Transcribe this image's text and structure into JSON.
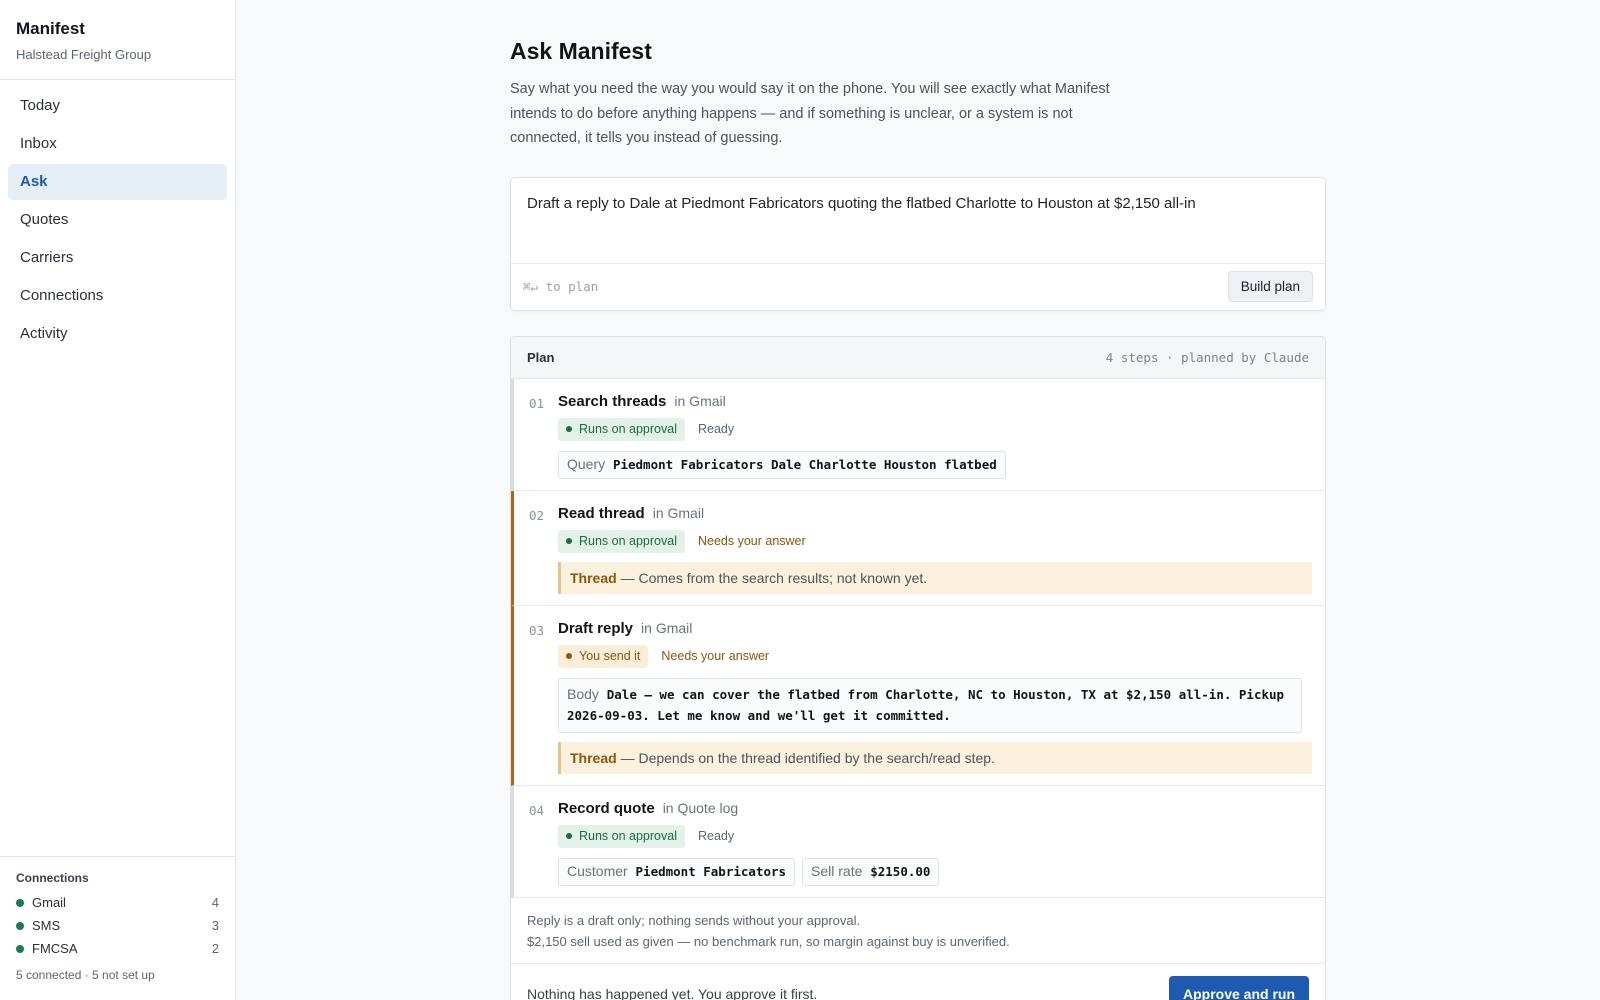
{
  "app": {
    "name": "Manifest",
    "org": "Halstead Freight Group"
  },
  "nav": [
    {
      "label": "Today",
      "active": false
    },
    {
      "label": "Inbox",
      "active": false
    },
    {
      "label": "Ask",
      "active": true
    },
    {
      "label": "Quotes",
      "active": false
    },
    {
      "label": "Carriers",
      "active": false
    },
    {
      "label": "Connections",
      "active": false
    },
    {
      "label": "Activity",
      "active": false
    }
  ],
  "connections": {
    "heading": "Connections",
    "items": [
      {
        "name": "Gmail",
        "count": "4"
      },
      {
        "name": "SMS",
        "count": "3"
      },
      {
        "name": "FMCSA",
        "count": "2"
      }
    ],
    "summary": "5 connected · 5 not set up"
  },
  "page": {
    "title": "Ask Manifest",
    "intro": "Say what you need the way you would say it on the phone. You will see exactly what Manifest intends to do before anything happens — and if something is unclear, or a system is not connected, it tells you instead of guessing."
  },
  "ask": {
    "text": "Draft a reply to Dale at Piedmont Fabricators quoting the flatbed Charlotte to Houston at $2,150 all-in",
    "hint": "⌘↵ to plan",
    "button": "Build plan"
  },
  "plan": {
    "title": "Plan",
    "meta": "4 steps · planned by Claude",
    "steps": [
      {
        "num": "01",
        "title": "Search threads",
        "system": "in Gmail",
        "badge": "Runs on approval",
        "status": "Ready",
        "fields": [
          {
            "label": "Query",
            "value": "Piedmont Fabricators Dale Charlotte Houston flatbed"
          }
        ]
      },
      {
        "num": "02",
        "title": "Read thread",
        "system": "in Gmail",
        "badge": "Runs on approval",
        "status": "Needs your answer",
        "unknown": {
          "label": "Thread",
          "text": "— Comes from the search results; not known yet."
        }
      },
      {
        "num": "03",
        "title": "Draft reply",
        "system": "in Gmail",
        "badge": "You send it",
        "status": "Needs your answer",
        "body": {
          "label": "Body",
          "value": "Dale — we can cover the flatbed from Charlotte, NC to Houston, TX at $2,150 all-in. Pickup 2026-09-03. Let me know and we'll get it committed."
        },
        "unknown": {
          "label": "Thread",
          "text": "— Depends on the thread identified by the search/read step."
        }
      },
      {
        "num": "04",
        "title": "Record quote",
        "system": "in Quote log",
        "badge": "Runs on approval",
        "status": "Ready",
        "fields": [
          {
            "label": "Customer",
            "value": "Piedmont Fabricators"
          },
          {
            "label": "Sell rate",
            "value": "$2150.00"
          }
        ]
      }
    ],
    "notes": [
      "Reply is a draft only; nothing sends without your approval.",
      "$2,150 sell used as given — no benchmark run, so margin against buy is unverified."
    ],
    "footer_text": "Nothing has happened yet. You approve it first.",
    "approve_button": "Approve and run"
  },
  "colors": {
    "accent": "#1c5bb0",
    "approval_badge": "#e3f2e9",
    "warn": "#a86a14",
    "connected_dot": "#1e7a4a"
  }
}
